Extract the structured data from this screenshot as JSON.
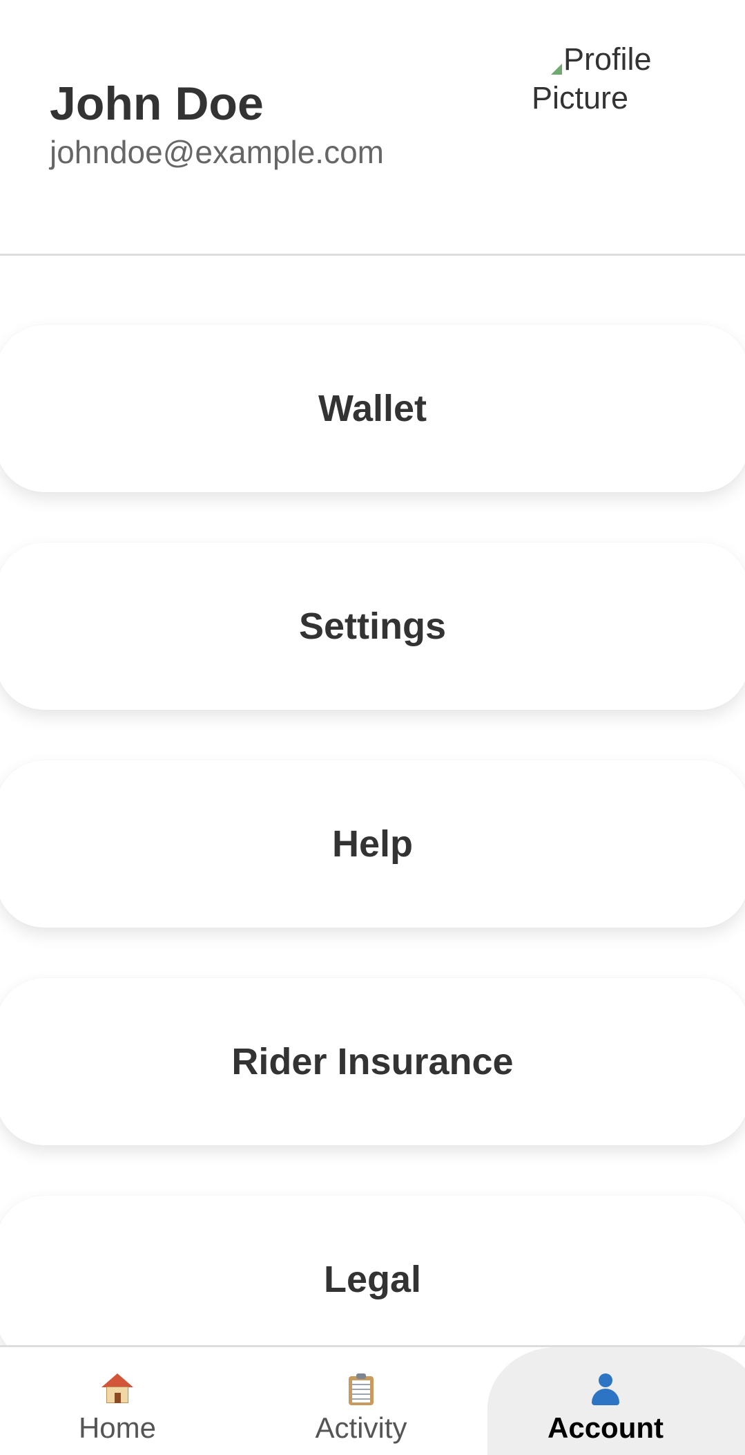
{
  "profile": {
    "name": "John Doe",
    "email": "johndoe@example.com",
    "avatar_alt": "Profile Picture"
  },
  "menu": {
    "items": [
      {
        "label": "Wallet"
      },
      {
        "label": "Settings"
      },
      {
        "label": "Help"
      },
      {
        "label": "Rider Insurance"
      },
      {
        "label": "Legal"
      }
    ]
  },
  "bottom_nav": {
    "items": [
      {
        "label": "Home",
        "icon": "house-icon"
      },
      {
        "label": "Activity",
        "icon": "clipboard-icon"
      },
      {
        "label": "Account",
        "icon": "user-icon",
        "active": true
      }
    ]
  },
  "colors": {
    "text_primary": "#333333",
    "text_secondary": "#666666",
    "divider": "#dddddd",
    "nav_active_bg": "#eeeeee",
    "nav_active_text": "#000000"
  }
}
